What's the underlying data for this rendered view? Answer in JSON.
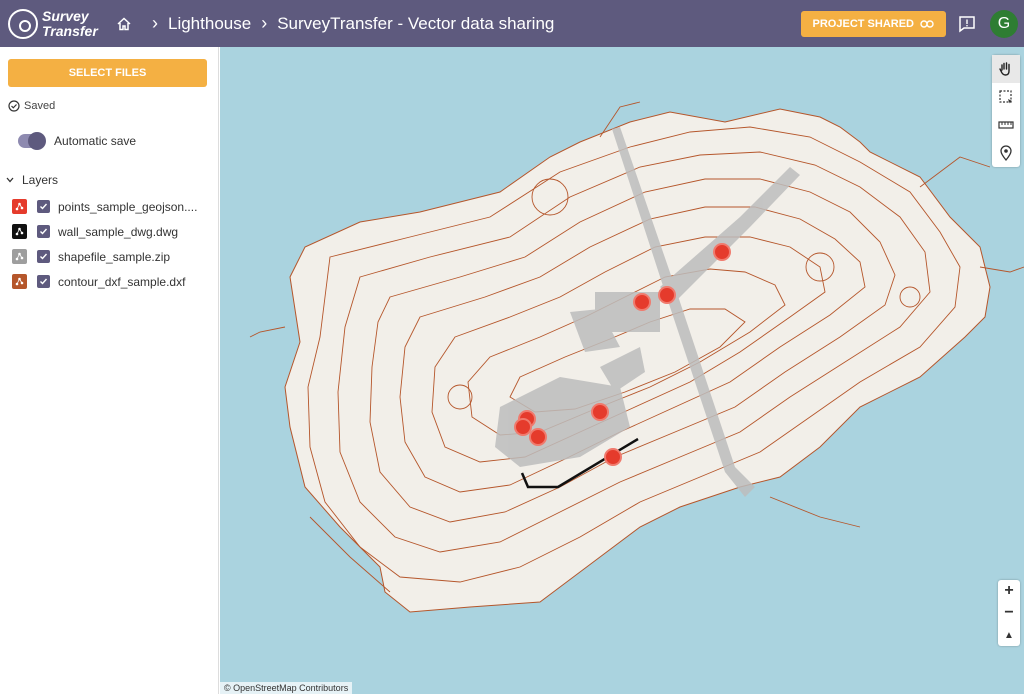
{
  "app": {
    "logo_line1": "Survey",
    "logo_line2": "Transfer"
  },
  "breadcrumb": {
    "item1": "Lighthouse",
    "item2": "SurveyTransfer - Vector data sharing"
  },
  "header": {
    "project_shared_label": "PROJECT SHARED",
    "avatar_initial": "G"
  },
  "sidebar": {
    "select_files_label": "SELECT FILES",
    "saved_label": "Saved",
    "auto_save_label": "Automatic save",
    "layers_label": "Layers",
    "layers": [
      {
        "name": "points_sample_geojson....",
        "color": "#e53b2c"
      },
      {
        "name": "wall_sample_dwg.dwg",
        "color": "#111111"
      },
      {
        "name": "shapefile_sample.zip",
        "color": "#9e9e9e"
      },
      {
        "name": "contour_dxf_sample.dxf",
        "color": "#b5562b"
      }
    ]
  },
  "map": {
    "attribution": "© OpenStreetMap Contributors",
    "zoom_in": "+",
    "zoom_out": "−",
    "compass": "▲",
    "colors": {
      "water": "#aad3df",
      "land": "#f2efe9",
      "contour": "#b5562b",
      "point": "#e53b2c"
    }
  }
}
